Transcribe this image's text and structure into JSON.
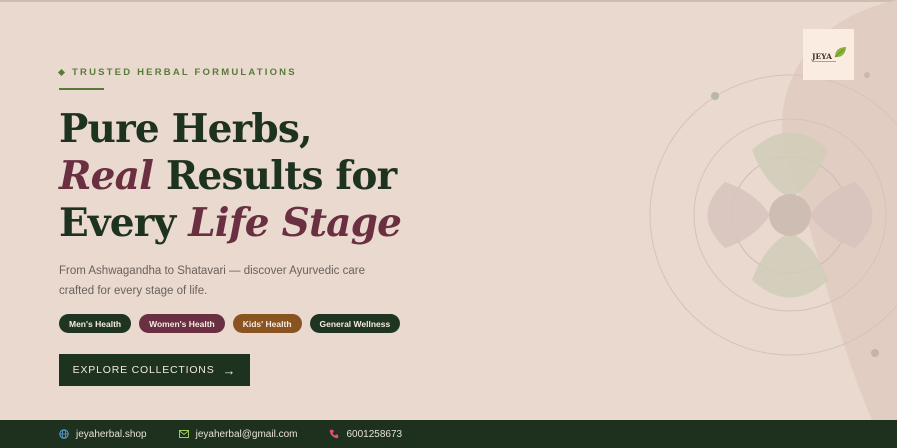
{
  "hero": {
    "eyebrow": "TRUSTED HERBAL FORMULATIONS",
    "headline": {
      "l1": "Pure Herbs,",
      "l2_em": "Real",
      "l2_rest": " Results for",
      "l3_start": "Every ",
      "l3_em": "Life Stage"
    },
    "subtext": "From Ashwagandha to Shatavari — discover Ayurvedic care crafted for every stage of life.",
    "tags": [
      "Men's Health",
      "Women's Health",
      "Kids' Health",
      "General Wellness"
    ],
    "cta_label": "EXPLORE COLLECTIONS",
    "cta_arrow": "→"
  },
  "logo": {
    "text": "JEYA"
  },
  "footer": {
    "website": "jeyaherbal.shop",
    "email": "jeyaherbal@gmail.com",
    "phone": "6001258673"
  },
  "colors": {
    "background": "#e9d9cf",
    "primary_green": "#1e3220",
    "accent_plum": "#6a2f40",
    "accent_brown": "#8a5420",
    "eyebrow_green": "#5a7a3a"
  },
  "icons": [
    "globe-icon",
    "mail-icon",
    "phone-icon",
    "arrow-right-icon",
    "leaf-logo-icon"
  ]
}
